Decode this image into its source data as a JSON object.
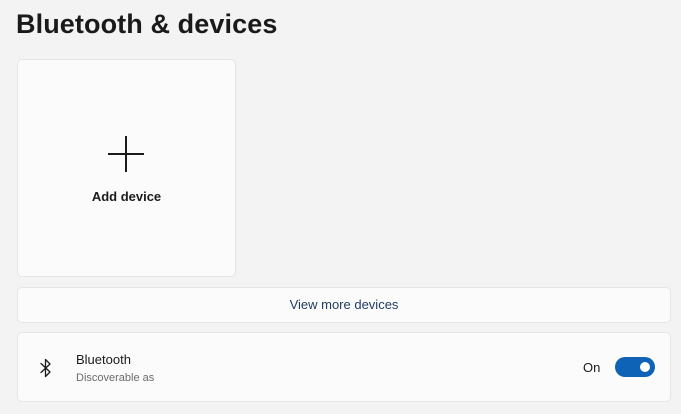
{
  "page": {
    "title": "Bluetooth & devices"
  },
  "add_device": {
    "label": "Add device",
    "icon": "plus-icon"
  },
  "view_more": {
    "label": "View more devices"
  },
  "bluetooth": {
    "icon": "bluetooth-icon",
    "title": "Bluetooth",
    "subtitle": "Discoverable as",
    "state_label": "On",
    "enabled": true
  },
  "colors": {
    "accent": "#0f63b7",
    "background": "#f3f3f3",
    "card": "#fbfbfb"
  }
}
